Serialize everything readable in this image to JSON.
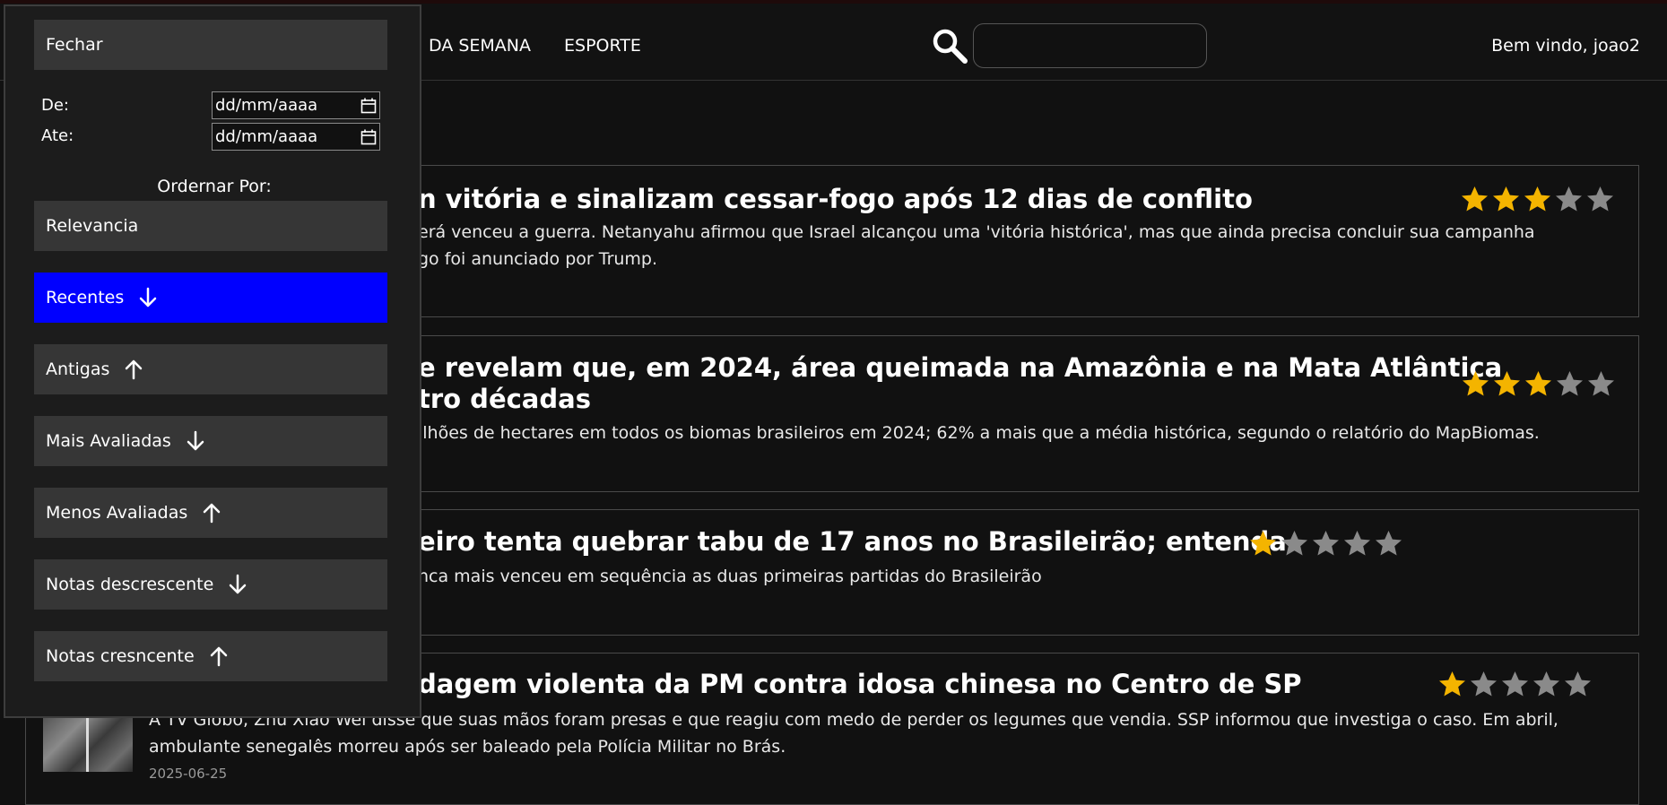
{
  "nav": {
    "links": [
      "DA SEMANA",
      "ESPORTE"
    ],
    "search_placeholder": "",
    "welcome": "Bem vindo, joao2"
  },
  "panel": {
    "close_label": "Fechar",
    "date_from_label": "De:",
    "date_to_label": "Ate:",
    "date_from_value": "dd/mm/aaaa",
    "date_to_value": "dd/mm/aaaa",
    "order_label": "Ordernar Por:",
    "options": [
      {
        "label": "Relevancia",
        "arrow": "none",
        "active": false
      },
      {
        "label": "Recentes",
        "arrow": "down",
        "active": true
      },
      {
        "label": "Antigas",
        "arrow": "up",
        "active": false
      },
      {
        "label": "Mais Avaliadas",
        "arrow": "down",
        "active": false
      },
      {
        "label": "Menos Avaliadas",
        "arrow": "up",
        "active": false
      },
      {
        "label": "Notas descrescente",
        "arrow": "down",
        "active": false
      },
      {
        "label": "Notas cresncente",
        "arrow": "up",
        "active": false
      }
    ]
  },
  "articles": [
    {
      "title": "n vitória e sinalizam cessar-fogo após 12 dias de conflito",
      "summary_lines": [
        "erá venceu a guerra. Netanyahu afirmou que Israel alcançou uma 'vitória histórica', mas que ainda precisa concluir sua campanha",
        "go foi anunciado por Trump."
      ],
      "rating": 3
    },
    {
      "title_lines": [
        "e revelam que, em 2024, área queimada na Amazônia e na Mata Atlântica",
        "tro décadas"
      ],
      "summary_lines": [
        "ilhões de hectares em todos os biomas brasileiros em 2024; 62% a mais que a média histórica, segundo o relatório do MapBiomas."
      ],
      "rating": 3
    },
    {
      "title": "eiro tenta quebrar tabu de 17 anos no Brasileirão; entenda",
      "summary_lines": [
        "nca mais venceu em sequência as duas primeiras partidas do Brasileirão"
      ],
      "rating": 1
    },
    {
      "title": "dagem violenta da PM contra idosa chinesa no Centro de SP",
      "summary_lines": [
        "A TV Globo, Zhu Xiao Wei disse que suas mãos foram presas e que reagiu com medo de perder os legumes que vendia. SSP informou que investiga o caso. Em abril,",
        "ambulante senegalês morreu após ser baleado pela Polícia Militar no Brás."
      ],
      "date": "2025-06-25",
      "rating": 1
    }
  ],
  "colors": {
    "star_filled": "#f4b400",
    "star_empty": "#8a8a8a",
    "active_option": "#0000ff"
  }
}
